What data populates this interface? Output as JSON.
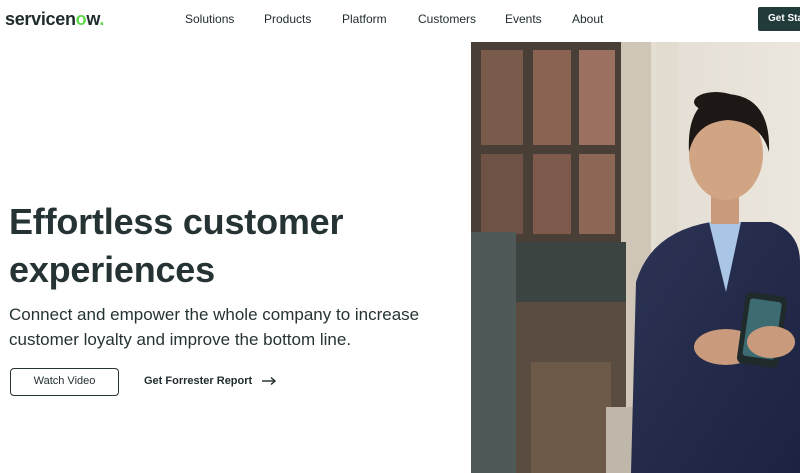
{
  "brand": {
    "name_main": "servicen",
    "name_o": "o",
    "name_end": "w",
    "mark": "."
  },
  "nav": {
    "items": [
      "Solutions",
      "Products",
      "Platform",
      "Customers",
      "Events",
      "About"
    ],
    "cta_label": "Get Star"
  },
  "hero": {
    "headline_line1": "Effortless customer",
    "headline_line2": "experiences",
    "subheadline": "Connect and empower the whole company to increase customer loyalty and improve the bottom line.",
    "primary_button": "Watch Video",
    "secondary_link": "Get Forrester Report"
  },
  "colors": {
    "accent": "#62d84e",
    "dark": "#213b3b",
    "text": "#263334"
  }
}
